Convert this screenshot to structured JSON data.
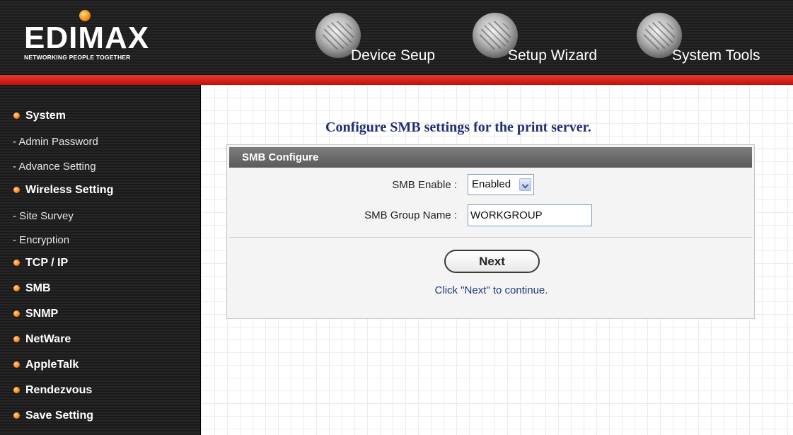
{
  "brand": {
    "logo_text": "EDIMAX",
    "tagline": "NETWORKING PEOPLE TOGETHER"
  },
  "header_nav": [
    {
      "label": "Device Seup",
      "icon": "device-globe-icon"
    },
    {
      "label": "Setup Wizard",
      "icon": "wizard-globe-icon"
    },
    {
      "label": "System Tools",
      "icon": "tools-globe-icon"
    }
  ],
  "sidebar": {
    "items": [
      {
        "label": "System",
        "type": "main"
      },
      {
        "label": "- Admin Password",
        "type": "sub"
      },
      {
        "label": "- Advance Setting",
        "type": "sub"
      },
      {
        "label": "Wireless Setting",
        "type": "main"
      },
      {
        "label": "- Site Survey",
        "type": "sub"
      },
      {
        "label": "- Encryption",
        "type": "sub"
      },
      {
        "label": "TCP / IP",
        "type": "main"
      },
      {
        "label": "SMB",
        "type": "main"
      },
      {
        "label": "SNMP",
        "type": "main"
      },
      {
        "label": "NetWare",
        "type": "main"
      },
      {
        "label": "AppleTalk",
        "type": "main"
      },
      {
        "label": "Rendezvous",
        "type": "main"
      },
      {
        "label": "Save Setting",
        "type": "main"
      }
    ]
  },
  "main": {
    "title": "Configure SMB settings for the print server.",
    "panel": {
      "header": "SMB Configure",
      "enable_label": "SMB Enable :",
      "enable_value": "Enabled",
      "group_label": "SMB Group Name :",
      "group_value": "WORKGROUP",
      "next_label": "Next",
      "hint": "Click \"Next\" to continue."
    }
  },
  "colors": {
    "header_bg": "#222222",
    "accent_red": "#d0201a",
    "title_blue": "#1f2f73",
    "bullet_orange": "#ff8a1c",
    "panel_header": "#6b6b6b"
  }
}
